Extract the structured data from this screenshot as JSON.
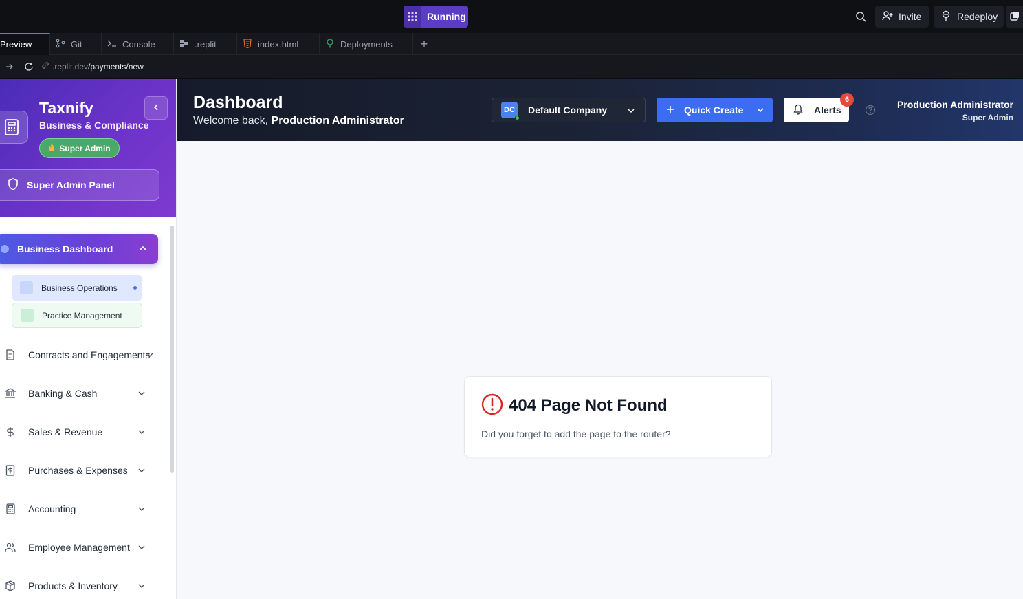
{
  "topbar": {
    "run_status": "Running",
    "invite_label": "Invite",
    "redeploy_label": "Redeploy"
  },
  "tabs": [
    {
      "label": "Preview",
      "icon": "preview-icon",
      "active": true
    },
    {
      "label": "Git",
      "icon": "git-icon"
    },
    {
      "label": "Console",
      "icon": "terminal-icon"
    },
    {
      "label": ".replit",
      "icon": "settings-file-icon"
    },
    {
      "label": "index.html",
      "icon": "html-file-icon"
    },
    {
      "label": "Deployments",
      "icon": "deployments-icon"
    }
  ],
  "urlbar": {
    "domain": ".replit.dev",
    "path": "/payments/new"
  },
  "sidebar": {
    "brand": "Taxnify",
    "brand_subtitle": "Business & Compliance",
    "role_badge": "Super Admin",
    "admin_panel_label": "Super Admin Panel",
    "active_section": "Business Dashboard",
    "sub_items": [
      {
        "label": "Business Operations"
      },
      {
        "label": "Practice Management"
      }
    ],
    "items": [
      {
        "label": "Contracts and Engagements",
        "icon": "document-icon"
      },
      {
        "label": "Banking & Cash",
        "icon": "bank-icon"
      },
      {
        "label": "Sales & Revenue",
        "icon": "dollar-icon"
      },
      {
        "label": "Purchases & Expenses",
        "icon": "receipt-icon"
      },
      {
        "label": "Accounting",
        "icon": "calculator-icon"
      },
      {
        "label": "Employee Management",
        "icon": "users-icon"
      },
      {
        "label": "Products & Inventory",
        "icon": "package-icon"
      }
    ]
  },
  "header": {
    "title": "Dashboard",
    "welcome_prefix": "Welcome back, ",
    "welcome_name": "Production Administrator",
    "company_initials": "DC",
    "company_name": "Default Company",
    "quick_create_label": "Quick Create",
    "alerts_label": "Alerts",
    "alerts_count": "6",
    "user_name": "Production Administrator",
    "user_role": "Super Admin"
  },
  "not_found": {
    "title": "404 Page Not Found",
    "message": "Did you forget to add the page to the router?"
  },
  "colors": {
    "accent": "#3b6df0",
    "sidebar_gradient_start": "#4a2cb8",
    "sidebar_gradient_end": "#7e3ad0",
    "run_pill": "#5b3cc4",
    "error": "#dc2626",
    "badge_green": "#4aa86a"
  }
}
